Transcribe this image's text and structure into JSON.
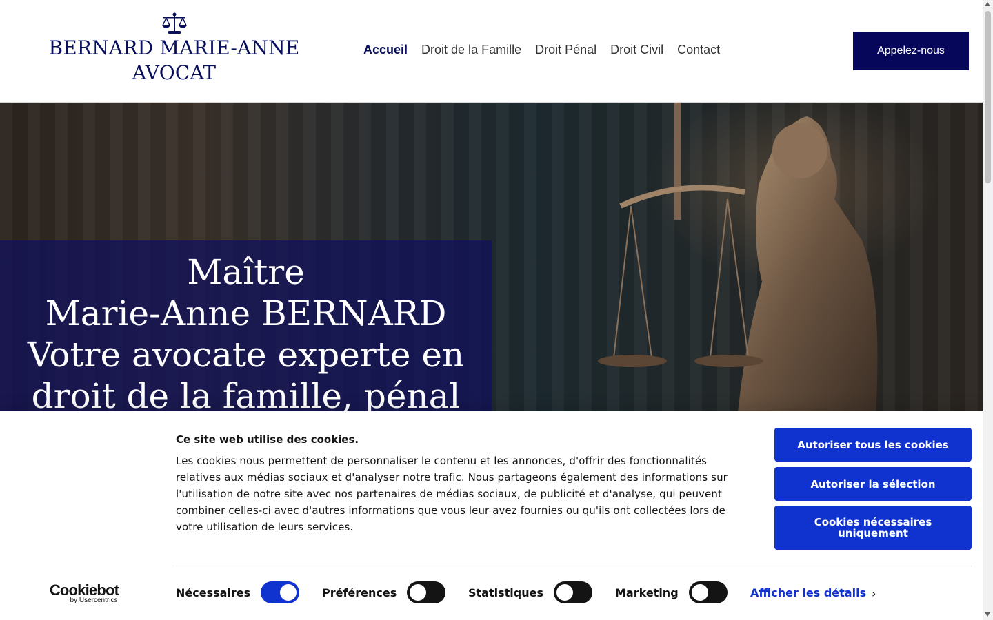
{
  "header": {
    "logo_line1": "BERNARD MARIE-ANNE",
    "logo_line2": "AVOCAT",
    "logo_icon": "scales-icon",
    "nav": [
      {
        "label": "Accueil",
        "active": true
      },
      {
        "label": "Droit de la Famille",
        "active": false
      },
      {
        "label": "Droit Pénal",
        "active": false
      },
      {
        "label": "Droit Civil",
        "active": false
      },
      {
        "label": "Contact",
        "active": false
      }
    ],
    "call_button": "Appelez-nous"
  },
  "hero": {
    "line1": "Maître",
    "line2": "Marie-Anne BERNARD",
    "line3": "Votre avocate experte en",
    "line4": "droit de la famille, pénal et"
  },
  "cookie_banner": {
    "title": "Ce site web utilise des cookies.",
    "text": "Les cookies nous permettent de personnaliser le contenu et les annonces, d'offrir des fonctionnalités relatives aux médias sociaux et d'analyser notre trafic. Nous partageons également des informations sur l'utilisation de notre site avec nos partenaires de médias sociaux, de publicité et d'analyse, qui peuvent combiner celles-ci avec d'autres informations que vous leur avez fournies ou qu'ils ont collectées lors de votre utilisation de leurs services.",
    "buttons": {
      "allow_all": "Autoriser tous les cookies",
      "allow_selection": "Autoriser la sélection",
      "necessary_only": "Cookies nécessaires uniquement"
    },
    "toggles": [
      {
        "label": "Nécessaires",
        "on": true
      },
      {
        "label": "Préférences",
        "on": false
      },
      {
        "label": "Statistiques",
        "on": false
      },
      {
        "label": "Marketing",
        "on": false
      }
    ],
    "details_link": "Afficher les détails",
    "brand": "Cookiebot",
    "brand_sub": "by Usercentrics"
  },
  "colors": {
    "brand_navy": "#0a0f5c",
    "button_navy": "#06075a",
    "cookie_blue": "#1032cf"
  }
}
